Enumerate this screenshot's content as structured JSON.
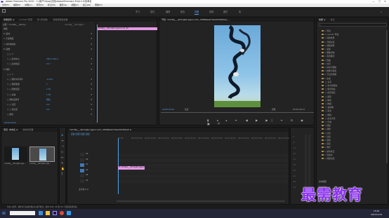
{
  "window": {
    "title": "Adobe Premiere Pro 2020 - C:\\用户\\fd\\ep\\文档\\Adobe\\Premiere Pro\\14.0\\未命名",
    "controls": [
      "—",
      "□",
      "✕"
    ]
  },
  "menu": [
    "文件(F)",
    "编辑(E)",
    "剪辑(C)",
    "序列(S)",
    "标记(M)",
    "图形(G)",
    "视图(V)",
    "窗口(W)",
    "帮助(H)"
  ],
  "workspaces": [
    {
      "label": "学习",
      "active": false
    },
    {
      "label": "组件",
      "active": false
    },
    {
      "label": "编辑",
      "active": false
    },
    {
      "label": "颜色",
      "active": false
    },
    {
      "label": "效果",
      "active": true
    },
    {
      "label": "音频",
      "active": false
    },
    {
      "label": "图形",
      "active": false
    },
    {
      "label": "库",
      "active": false
    }
  ],
  "effect_controls": {
    "tabs": [
      "效果控件 ≡",
      "Lumetri 范围",
      "源:(无剪辑)",
      "音频剪辑混合器:"
    ],
    "source_line": "主要 * cxm4bj___9kmig...",
    "clip_line": "cxm4bj___9kmig6x...",
    "rows": [
      {
        "label": "视频",
        "value": "",
        "type": "header"
      },
      {
        "label": "fx 运动",
        "value": "",
        "type": "group"
      },
      {
        "label": "> 不透明度",
        "value": "",
        "type": "group"
      },
      {
        "label": "> 时间重映射",
        "value": "",
        "type": "group"
      },
      {
        "label": "fx 镜像",
        "value": "",
        "type": "group"
      },
      {
        "label": "○ ▢ ✎",
        "value": "",
        "type": "tools"
      },
      {
        "label": "> ○ 反射中心",
        "value": "360.0  540.0",
        "type": "param"
      },
      {
        "label": "> ○ 反射角度",
        "value": "0.0 °",
        "type": "param"
      },
      {
        "label": "fx 残影",
        "value": "",
        "type": "group"
      },
      {
        "label": "○ ▢ ✎",
        "value": "",
        "type": "tools"
      },
      {
        "label": "> ○ 残影时间(秒)",
        "value": "-0.033",
        "type": "param"
      },
      {
        "label": "> ○ 残影数量",
        "value": "1",
        "type": "param"
      },
      {
        "label": "> ○ 起始强度",
        "value": "1.00",
        "type": "param"
      },
      {
        "label": "> ○ 衰减",
        "value": "1.00",
        "type": "param"
      },
      {
        "label": "○ 残影运算符",
        "value": "相加",
        "type": "param"
      },
      {
        "label": "> ○ 亮度",
        "value": "0.0",
        "type": "param"
      },
      {
        "label": "> ○ 对比度",
        "value": "0.0",
        "type": "param"
      },
      {
        "label": "○ 颜色",
        "value": "",
        "type": "param"
      }
    ],
    "timecode": "00:00:00:00",
    "mini_clip": "cxm4bj___9kmig6x.qqpucuom_30"
  },
  "program_monitor": {
    "tab": "节目: cxm4bj___9kmig6x.qqpucuom_30366aeb74ea15430ba9_...",
    "timecode_left": "00:00:00:00",
    "fit": "适合",
    "quality": "完整",
    "timecode_right": "00:00:28:13"
  },
  "project": {
    "tabs": [
      "项目: 未命名 ≡",
      "媒体浏览器"
    ],
    "items": [
      {
        "name": "cxm4bj___9kmig6x.qqp...",
        "duration": "28:13"
      },
      {
        "name": "cxm4bj___9kmig6x.qqp...",
        "duration": "28:13"
      }
    ]
  },
  "timeline": {
    "tab": "cxm4bj___9kmig6x.qqpucuom_30366aeb74ea15430ba9 ≡",
    "timecode": "00:00:00:00",
    "ruler": [
      "00:00",
      "00:00:05:00",
      "00:00:10:00",
      "00:00:15:00",
      "00:00:20:00",
      "00:00:25:00",
      "00:00:30:00",
      "00:00:35:00",
      "00:00:40:00",
      "00:00:45:00",
      "00:00:50:00",
      "00:00:55:00",
      "00:01:00:00"
    ],
    "tracks": [
      "V3",
      "V2",
      "V1",
      "A1",
      "A2",
      "A3"
    ],
    "clip": "fx cxm4bj___9kmig6x.qqpucuom",
    "master": "主声道  0.0"
  },
  "effects_panel": {
    "tabs": [
      "效果 ≡",
      "标记"
    ],
    "tree": [
      "> 预设",
      "> Lumetri 预设",
      "> 音频效果",
      "> 音频过渡",
      "> 视频效果",
      "> 变换",
      "> 图像控制",
      "> 实用程序",
      "> 扭曲",
      "> 时间",
      "> 杂色与颗粒",
      "> 模糊与锐化",
      "> 沉浸式视频",
      "> 生成",
      "  □ 书写",
      "  □ 单元格图案",
      "  □ 吸管填充",
      "  □ 四色渐变",
      "  □ 圆形",
      "  □ 棋盘",
      "  □ 椭圆",
      "  □ 油漆桶",
      "  □ 渐变",
      "  □ 网格",
      "  □ 镜头光晕",
      "  □ 闪电",
      "> 视频",
      "> 调整",
      "> 过时",
      "> 过渡",
      "> 透视",
      "> 通道",
      "> 键控",
      "> 颜色校正",
      "> 风格化",
      "> 视频过渡"
    ],
    "lower": [
      "基本图形",
      "基本声音",
      "Lumetri 颜色"
    ]
  },
  "status": {
    "message": "单击以选择，或单击空白处并拖动以进行框选。使用 Shift, Alt 和 Ctrl 可获得其他选项。"
  },
  "taskbar": {
    "time": "15:49",
    "date": "2021/11/19"
  },
  "watermark": "最需教育",
  "colors": {
    "accent": "#4f9fe8",
    "clip": "#e499e4",
    "watermark": "#8b2ff0"
  }
}
